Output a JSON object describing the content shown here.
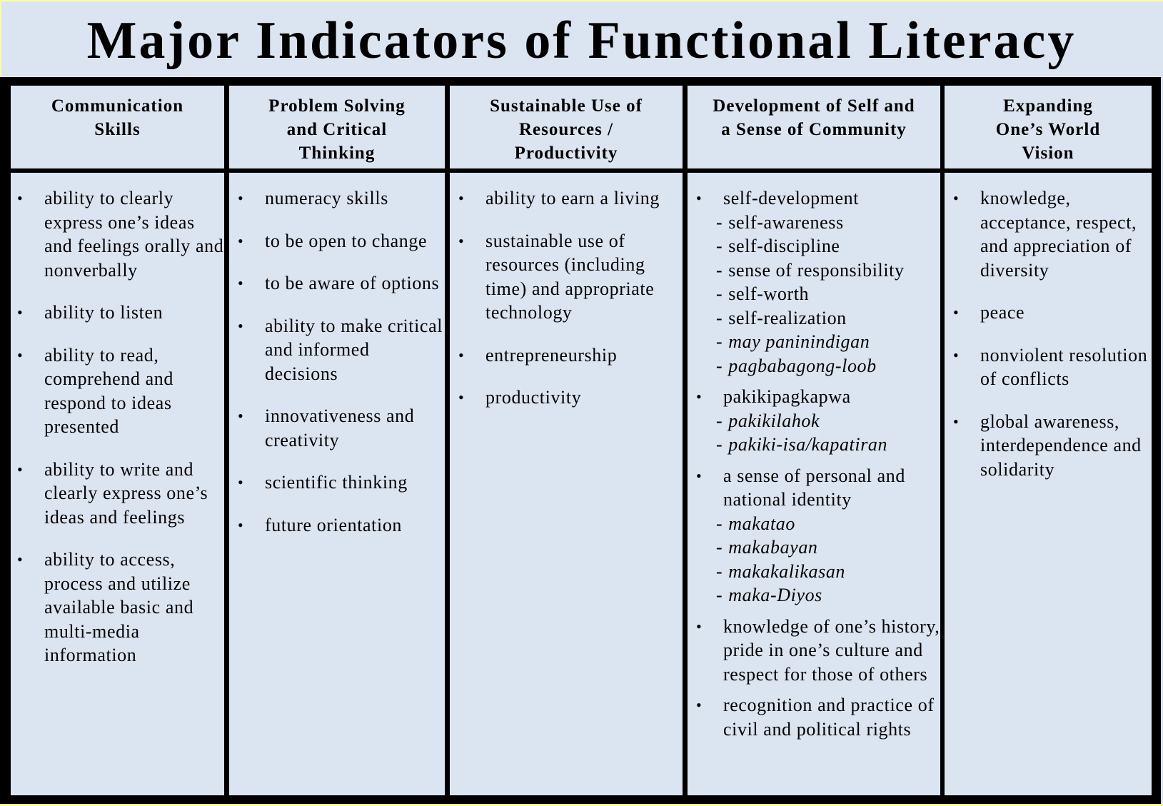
{
  "title": "Major Indicators of Functional Literacy",
  "colors": {
    "background": "#dbe5f1",
    "border": "#000000",
    "frame": "#fdfd9a"
  },
  "columns": [
    {
      "header": [
        "Communication",
        "Skills"
      ],
      "items": [
        {
          "text": "ability to clearly express one’s ideas and feelings orally and nonverbally"
        },
        {
          "text": "ability to listen"
        },
        {
          "text": "ability to read, comprehend and respond to ideas presented"
        },
        {
          "text": "ability to write and clearly express one’s ideas and feelings"
        },
        {
          "text": "ability to access, process and utilize available basic and multi-media information"
        }
      ]
    },
    {
      "header": [
        "Problem Solving",
        "and Critical",
        "Thinking"
      ],
      "items": [
        {
          "text": "numeracy skills"
        },
        {
          "text": "to be open to change"
        },
        {
          "text": "to be aware of options"
        },
        {
          "text": "ability to make critical and informed decisions"
        },
        {
          "text": "innovativeness and creativity"
        },
        {
          "text": "scientific thinking"
        },
        {
          "text": "future orientation"
        }
      ]
    },
    {
      "header": [
        "Sustainable Use of",
        "Resources /",
        "Productivity"
      ],
      "items": [
        {
          "text": "ability to earn a living"
        },
        {
          "text": "sustainable use of resources (including time) and appropriate technology"
        },
        {
          "text": "entrepreneurship"
        },
        {
          "text": "productivity"
        }
      ]
    },
    {
      "header": [
        "Development of Self and",
        "a Sense of Community"
      ],
      "items": [
        {
          "text": "self-development",
          "subs": [
            {
              "text": "self-awareness",
              "italic": false
            },
            {
              "text": "self-discipline",
              "italic": false
            },
            {
              "text": "sense of responsibility",
              "italic": false
            },
            {
              "text": "self-worth",
              "italic": false
            },
            {
              "text": "self-realization",
              "italic": false
            },
            {
              "text": "may paninindigan",
              "italic": true
            },
            {
              "text": "pagbabagong-loob",
              "italic": true
            }
          ]
        },
        {
          "text": "pakikipagkapwa",
          "subs": [
            {
              "text": "pakikilahok",
              "italic": true
            },
            {
              "text": "pakiki-isa/kapatiran",
              "italic": true
            }
          ]
        },
        {
          "text": "a sense of personal and national identity",
          "subs": [
            {
              "text": "makatao",
              "italic": true
            },
            {
              "text": "makabayan",
              "italic": true
            },
            {
              "text": "makakalikasan",
              "italic": true
            },
            {
              "text": "maka-Diyos",
              "italic": true
            }
          ]
        },
        {
          "text": "knowledge of one’s history, pride in one’s culture and respect for those of others"
        },
        {
          "text": "recognition and practice of civil and political rights"
        }
      ]
    },
    {
      "header": [
        "Expanding",
        "One’s World",
        "Vision"
      ],
      "items": [
        {
          "text": "knowledge, acceptance, respect, and appreciation of diversity"
        },
        {
          "text": "peace"
        },
        {
          "text": "nonviolent resolution of conflicts"
        },
        {
          "text": "global awareness, interdependence and solidarity"
        }
      ]
    }
  ],
  "bullet_glyph": "•",
  "dash_glyph": "-"
}
